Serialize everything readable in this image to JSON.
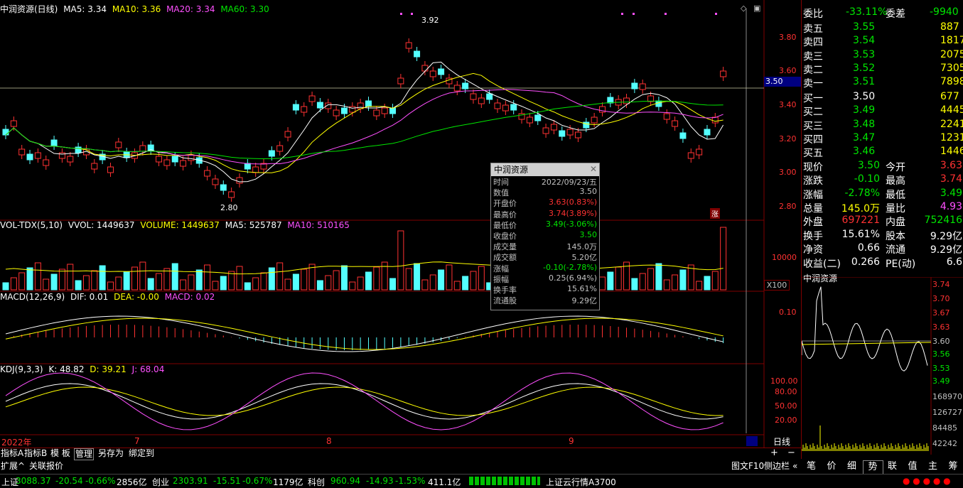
{
  "price_legend": {
    "title": "中润资源(日线)",
    "ma5": "MA5: 3.34",
    "ma10": "MA10: 3.36",
    "ma20": "MA20: 3.34",
    "ma60": "MA60: 3.30"
  },
  "vol_legend": {
    "title": "VOL-TDX(5,10)",
    "vvol": "VVOL: 1449637",
    "volume": "VOLUME: 1449637",
    "ma5": "MA5: 525787",
    "ma10": "MA10: 510165"
  },
  "macd_legend": {
    "title": "MACD(12,26,9)",
    "dif": "DIF: 0.01",
    "dea": "DEA: -0.00",
    "macd": "MACD: 0.02"
  },
  "kdj_legend": {
    "title": "KDJ(9,3,3)",
    "k": "K: 48.82",
    "d": "D: 39.21",
    "j": "J: 68.04"
  },
  "price_axis": [
    "3.80",
    "3.60",
    "3.40",
    "3.20",
    "3.00",
    "2.80"
  ],
  "price_marker": "3.50",
  "high_label": "3.92",
  "low_label": "2.80",
  "zhang_label": "涨",
  "vol_axis": [
    "10000"
  ],
  "vol_unit": "X100",
  "macd_axis": [
    "0.10"
  ],
  "kdj_axis": [
    "100.00",
    "80.00",
    "50.00",
    "20.00"
  ],
  "date_axis": {
    "year": "2022年",
    "m7": "7",
    "m8": "8",
    "m9": "9"
  },
  "period_label": "日线",
  "tooltip": {
    "title": "中润资源",
    "rows": [
      {
        "k": "时间",
        "v": "2022/09/23/五",
        "c": "#c0c0c0"
      },
      {
        "k": "数值",
        "v": "3.50",
        "c": "#c0c0c0"
      },
      {
        "k": "开盘价",
        "v": "3.63(0.83%)",
        "c": "#ff3232"
      },
      {
        "k": "最高价",
        "v": "3.74(3.89%)",
        "c": "#ff3232"
      },
      {
        "k": "最低价",
        "v": "3.49(-3.06%)",
        "c": "#00e600"
      },
      {
        "k": "收盘价",
        "v": "3.50",
        "c": "#00e600"
      },
      {
        "k": "成交量",
        "v": "145.0万",
        "c": "#c0c0c0"
      },
      {
        "k": "成交额",
        "v": "5.20亿",
        "c": "#c0c0c0"
      },
      {
        "k": "涨幅",
        "v": "-0.10(-2.78%)",
        "c": "#00e600"
      },
      {
        "k": "振幅",
        "v": "0.25(6.94%)",
        "c": "#c0c0c0"
      },
      {
        "k": "换手率",
        "v": "15.61%",
        "c": "#c0c0c0"
      },
      {
        "k": "流通股",
        "v": "9.29亿",
        "c": "#c0c0c0"
      }
    ]
  },
  "bottom_tabs": [
    "指标A",
    "指标B",
    "模 板",
    "管理",
    "另存为",
    "绑定到"
  ],
  "bottom_tabs2": [
    "扩展^",
    "关联报价"
  ],
  "right": {
    "weibi": {
      "k": "委比",
      "v": "-33.11%",
      "k2": "委差",
      "v2": "-9940"
    },
    "asks": [
      {
        "k": "卖五",
        "p": "3.55",
        "q": "887"
      },
      {
        "k": "卖四",
        "p": "3.54",
        "q": "1817"
      },
      {
        "k": "卖三",
        "p": "3.53",
        "q": "2075"
      },
      {
        "k": "卖二",
        "p": "3.52",
        "q": "7305"
      },
      {
        "k": "卖一",
        "p": "3.51",
        "q": "7898"
      }
    ],
    "bids": [
      {
        "k": "买一",
        "p": "3.50",
        "q": "677"
      },
      {
        "k": "买二",
        "p": "3.49",
        "q": "4445"
      },
      {
        "k": "买三",
        "p": "3.48",
        "q": "2241"
      },
      {
        "k": "买四",
        "p": "3.47",
        "q": "1231"
      },
      {
        "k": "买五",
        "p": "3.46",
        "q": "1446"
      }
    ],
    "stats": [
      {
        "k": "现价",
        "v": "3.50",
        "vc": "#00e600",
        "k2": "今开",
        "v2": "3.63",
        "v2c": "#ff3232"
      },
      {
        "k": "涨跌",
        "v": "-0.10",
        "vc": "#00e600",
        "k2": "最高",
        "v2": "3.74",
        "v2c": "#ff3232"
      },
      {
        "k": "涨幅",
        "v": "-2.78%",
        "vc": "#00e600",
        "k2": "最低",
        "v2": "3.49",
        "v2c": "#00e600"
      },
      {
        "k": "总量",
        "v": "145.0万",
        "vc": "#ffff00",
        "k2": "量比",
        "v2": "4.93",
        "v2c": "#ff50ff"
      },
      {
        "k": "外盘",
        "v": "697221",
        "vc": "#ff3232",
        "k2": "内盘",
        "v2": "752416",
        "v2c": "#00e600"
      }
    ],
    "fund": [
      {
        "k": "换手",
        "v": "15.61%",
        "k2": "股本",
        "v2": "9.29亿"
      },
      {
        "k": "净资",
        "v": "0.66",
        "k2": "流通",
        "v2": "9.29亿"
      },
      {
        "k": "收益(二)",
        "v": "0.266",
        "k2": "PE(动)",
        "v2": "6.6"
      }
    ],
    "mini_title": "中润资源",
    "mini_axis": [
      "3.74",
      "3.70",
      "3.67",
      "3.63",
      "3.60",
      "3.56",
      "3.53",
      "3.49"
    ],
    "mini_vol_axis": [
      "168970",
      "126727",
      "84485",
      "42242"
    ],
    "panel_tabs": [
      "笔",
      "价",
      "细",
      "势",
      "联",
      "值",
      "主",
      "筹"
    ]
  },
  "side_links": {
    "f10": "图文F10",
    "side": "侧边栏",
    "dbl": "«"
  },
  "status": {
    "sh_name": "上证",
    "sh_val": "3088.37",
    "sh_chg": "-20.54",
    "sh_pct": "-0.66%",
    "sh_amt": "2856亿",
    "cy_name": "创业",
    "cy_val": "2303.91",
    "cy_chg": "-15.51",
    "cy_pct": "-0.67%",
    "cy_amt": "1179亿",
    "kc_name": "科创",
    "kc_val": "960.94",
    "kc_chg": "-14.93",
    "kc_pct": "-1.53%",
    "kc_amt": "411.1亿",
    "cloud": "上证云行情A3700"
  }
}
